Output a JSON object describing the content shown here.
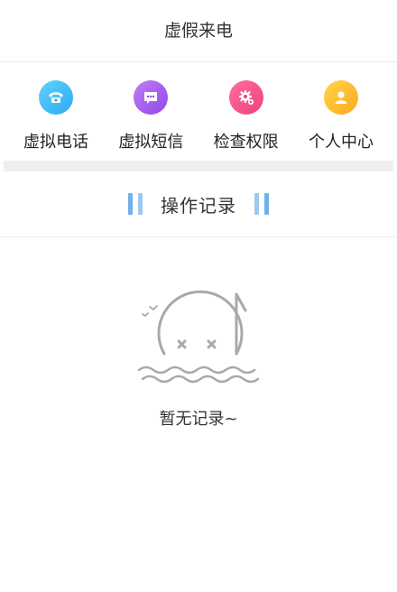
{
  "header": {
    "title": "虚假来电"
  },
  "quick_nav": {
    "items": [
      {
        "label": "虚拟电话",
        "icon": "phone-icon",
        "color_start": "#5fd3ff",
        "color_end": "#2fa8f2"
      },
      {
        "label": "虚拟短信",
        "icon": "message-icon",
        "color_start": "#c07ef7",
        "color_end": "#9346e6"
      },
      {
        "label": "检查权限",
        "icon": "gear-icon",
        "color_start": "#ff6fa4",
        "color_end": "#f0407a"
      },
      {
        "label": "个人中心",
        "icon": "person-icon",
        "color_start": "#ffd44a",
        "color_end": "#ffaa1c"
      }
    ]
  },
  "records": {
    "title": "操作记录",
    "accent": "#9dc8f0"
  },
  "empty_state": {
    "icon": "empty-note-icon",
    "text": "暂无记录~"
  }
}
